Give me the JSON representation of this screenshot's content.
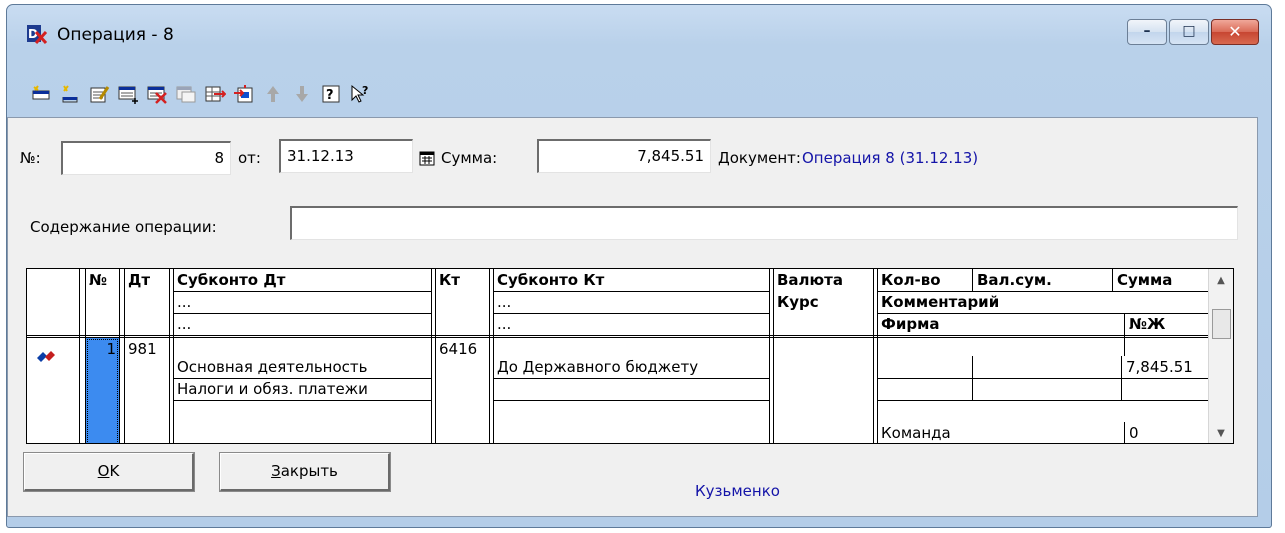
{
  "window": {
    "title": "Операция - 8",
    "controls": {
      "minimize": "–",
      "maximize": "□",
      "close": "✕"
    }
  },
  "toolbar": {
    "icons": [
      "new-row-icon",
      "new-group-icon",
      "edit-icon",
      "insert-row-icon",
      "delete-row-icon",
      "copy-row-icon",
      "move-row-icon",
      "table-icon",
      "move-up-icon",
      "move-down-icon",
      "help-icon",
      "context-help-icon"
    ]
  },
  "form": {
    "number_label": "№:",
    "number_value": "8",
    "date_label": "от:",
    "date_value": "31.12.13",
    "sum_label": "Сумма:",
    "sum_value": "7,845.51",
    "document_label": "Документ:",
    "document_value": "Операция 8 (31.12.13)",
    "content_label": "Содержание операции:",
    "content_value": ""
  },
  "grid": {
    "headers": {
      "num": "№",
      "dt": "Дт",
      "subconto_dt": "Субконто Дт",
      "dots1": "...",
      "dots2": "...",
      "kt": "Кт",
      "subconto_kt": "Субконто Кт",
      "dots3": "...",
      "dots4": "...",
      "currency": "Валюта",
      "rate": "Курс",
      "qty": "Кол-во",
      "cur_sum": "Вал.сум.",
      "sum": "Сумма",
      "comment": "Комментарий",
      "firm": "Фирма",
      "journal_no": "№Ж"
    },
    "rows": [
      {
        "num": "1",
        "dt": "981",
        "subconto_dt_1": "Основная деятельность",
        "subconto_dt_2": "Налоги и обяз. платежи",
        "subconto_dt_3": "",
        "kt": "6416",
        "subconto_kt_1": "До Державного бюджету",
        "subconto_kt_2": "",
        "subconto_kt_3": "",
        "currency": "",
        "qty": "",
        "cur_sum": "",
        "sum": "7,845.51",
        "comment": "",
        "firm": "Команда",
        "journal_no": "0"
      }
    ]
  },
  "buttons": {
    "ok_label": "OK",
    "ok_mnemonic": "O",
    "ok_rest": "K",
    "close_label": "Закрыть",
    "close_mnemonic": "З",
    "close_rest": "акрыть"
  },
  "footer": {
    "user": "Кузьменко"
  }
}
